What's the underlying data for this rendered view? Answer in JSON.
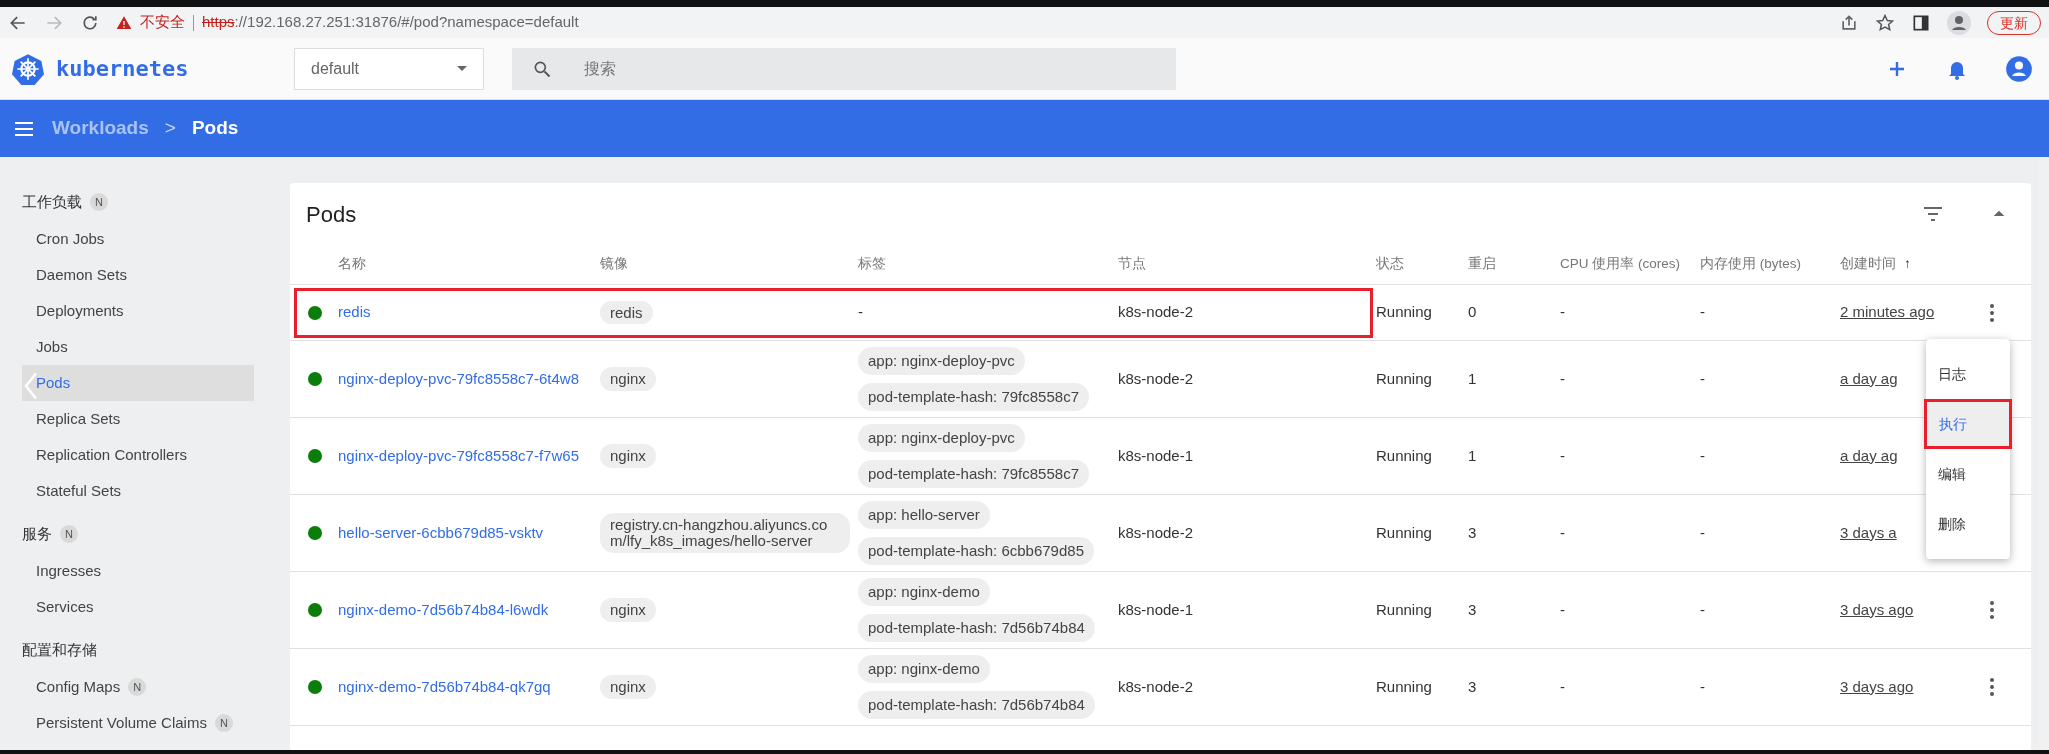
{
  "browser": {
    "security_warning": "不安全",
    "url_scheme": "https",
    "url_rest": "://192.168.27.251:31876/#/pod?namespace=default",
    "update_button": "更新"
  },
  "header": {
    "logo_text": "kubernetes",
    "namespace": "default",
    "search": {
      "placeholder": "搜索"
    }
  },
  "breadcrumb": {
    "parent": "Workloads",
    "separator": ">",
    "current": "Pods"
  },
  "sidebar": {
    "sections": [
      {
        "title": "工作负载",
        "badge": "N",
        "items": [
          {
            "label": "Cron Jobs",
            "selected": false
          },
          {
            "label": "Daemon Sets",
            "selected": false
          },
          {
            "label": "Deployments",
            "selected": false
          },
          {
            "label": "Jobs",
            "selected": false
          },
          {
            "label": "Pods",
            "selected": true
          },
          {
            "label": "Replica Sets",
            "selected": false
          },
          {
            "label": "Replication Controllers",
            "selected": false
          },
          {
            "label": "Stateful Sets",
            "selected": false
          }
        ]
      },
      {
        "title": "服务",
        "badge": "N",
        "items": [
          {
            "label": "Ingresses",
            "selected": false
          },
          {
            "label": "Services",
            "selected": false
          }
        ]
      },
      {
        "title": "配置和存储",
        "items": [
          {
            "label": "Config Maps",
            "selected": false,
            "badge": "N"
          },
          {
            "label": "Persistent Volume Claims",
            "selected": false,
            "badge": "N"
          }
        ]
      }
    ]
  },
  "card": {
    "title": "Pods",
    "columns": [
      "名称",
      "镜像",
      "标签",
      "节点",
      "状态",
      "重启",
      "CPU 使用率 (cores)",
      "内存使用 (bytes)",
      "创建时间"
    ],
    "sort_indicator": "↑",
    "rows": [
      {
        "name": "redis",
        "image": "redis",
        "labels": [],
        "labels_empty": "-",
        "node": "k8s-node-2",
        "status": "Running",
        "restarts": "0",
        "cpu": "-",
        "memory": "-",
        "created": "2 minutes ago",
        "highlighted": true
      },
      {
        "name": "nginx-deploy-pvc-79fc8558c7-6t4w8",
        "image": "nginx",
        "labels": [
          "app: nginx-deploy-pvc",
          "pod-template-hash: 79fc8558c7"
        ],
        "node": "k8s-node-2",
        "status": "Running",
        "restarts": "1",
        "cpu": "-",
        "memory": "-",
        "created": "a day ag",
        "highlighted": false
      },
      {
        "name": "nginx-deploy-pvc-79fc8558c7-f7w65",
        "image": "nginx",
        "labels": [
          "app: nginx-deploy-pvc",
          "pod-template-hash: 79fc8558c7"
        ],
        "node": "k8s-node-1",
        "status": "Running",
        "restarts": "1",
        "cpu": "-",
        "memory": "-",
        "created": "a day ag",
        "highlighted": false
      },
      {
        "name": "hello-server-6cbb679d85-vsktv",
        "image": "registry.cn-hangzhou.aliyuncs.com/lfy_k8s_images/hello-server",
        "labels": [
          "app: hello-server",
          "pod-template-hash: 6cbb679d85"
        ],
        "node": "k8s-node-2",
        "status": "Running",
        "restarts": "3",
        "cpu": "-",
        "memory": "-",
        "created": "3 days a",
        "highlighted": false
      },
      {
        "name": "nginx-demo-7d56b74b84-l6wdk",
        "image": "nginx",
        "labels": [
          "app: nginx-demo",
          "pod-template-hash: 7d56b74b84"
        ],
        "node": "k8s-node-1",
        "status": "Running",
        "restarts": "3",
        "cpu": "-",
        "memory": "-",
        "created": "3 days ago",
        "highlighted": false
      },
      {
        "name": "nginx-demo-7d56b74b84-qk7gq",
        "image": "nginx",
        "labels": [
          "app: nginx-demo",
          "pod-template-hash: 7d56b74b84"
        ],
        "node": "k8s-node-2",
        "status": "Running",
        "restarts": "3",
        "cpu": "-",
        "memory": "-",
        "created": "3 days ago",
        "highlighted": false
      }
    ]
  },
  "context_menu": {
    "items": [
      {
        "label": "日志",
        "selected": false,
        "highlighted": false
      },
      {
        "label": "执行",
        "selected": true,
        "highlighted": true
      },
      {
        "label": "编辑",
        "selected": false,
        "highlighted": false
      },
      {
        "label": "删除",
        "selected": false,
        "highlighted": false
      }
    ]
  }
}
